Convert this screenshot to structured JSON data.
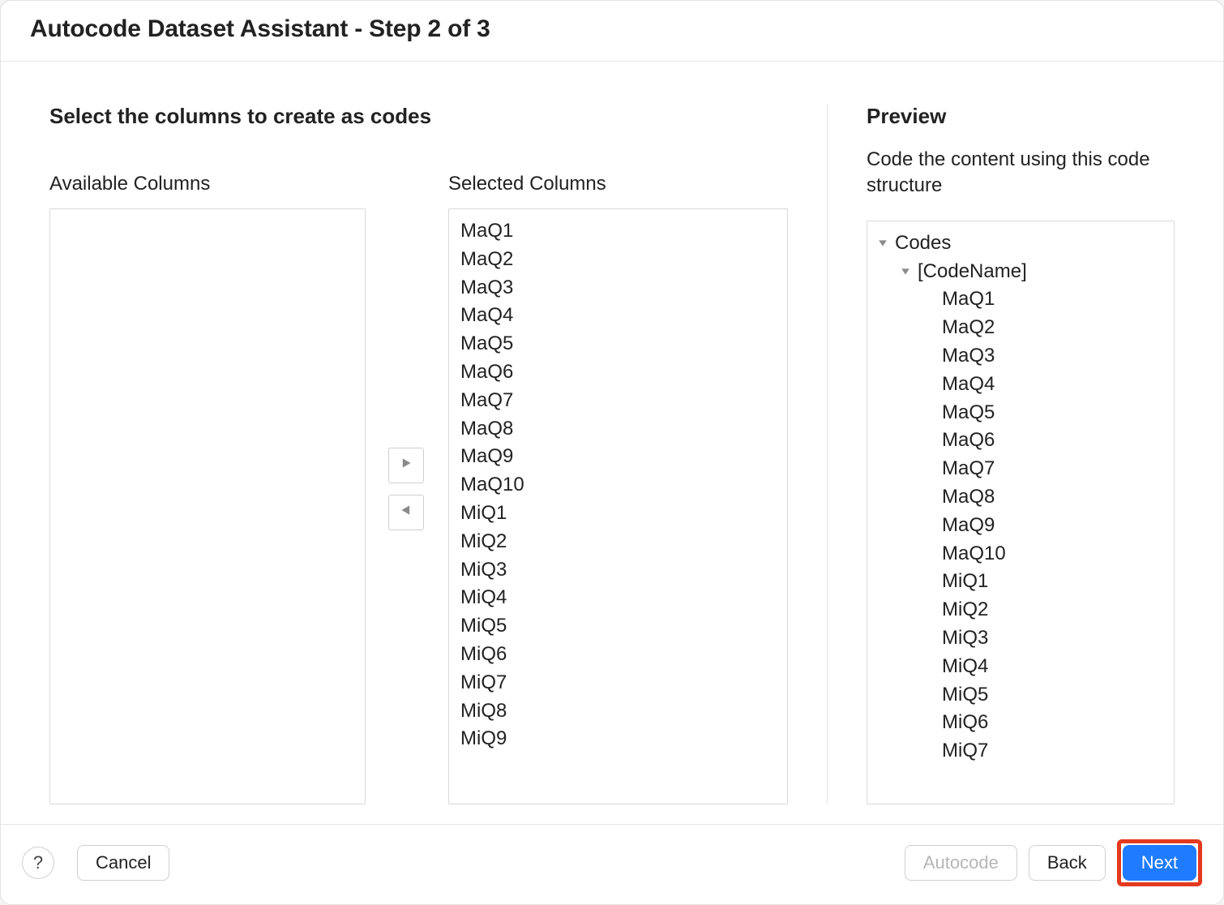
{
  "window": {
    "title": "Autocode Dataset Assistant - Step 2 of 3"
  },
  "left": {
    "heading": "Select the columns to create as codes",
    "available_label": "Available Columns",
    "selected_label": "Selected Columns",
    "available_columns": [],
    "selected_columns": [
      "MaQ1",
      "MaQ2",
      "MaQ3",
      "MaQ4",
      "MaQ5",
      "MaQ6",
      "MaQ7",
      "MaQ8",
      "MaQ9",
      "MaQ10",
      "MiQ1",
      "MiQ2",
      "MiQ3",
      "MiQ4",
      "MiQ5",
      "MiQ6",
      "MiQ7",
      "MiQ8",
      "MiQ9"
    ]
  },
  "preview": {
    "heading": "Preview",
    "description": "Code the content using this code structure",
    "root_label": "Codes",
    "codename_label": "[CodeName]",
    "leaves": [
      "MaQ1",
      "MaQ2",
      "MaQ3",
      "MaQ4",
      "MaQ5",
      "MaQ6",
      "MaQ7",
      "MaQ8",
      "MaQ9",
      "MaQ10",
      "MiQ1",
      "MiQ2",
      "MiQ3",
      "MiQ4",
      "MiQ5",
      "MiQ6",
      "MiQ7"
    ]
  },
  "footer": {
    "help": "?",
    "cancel": "Cancel",
    "autocode": "Autocode",
    "back": "Back",
    "next": "Next"
  }
}
